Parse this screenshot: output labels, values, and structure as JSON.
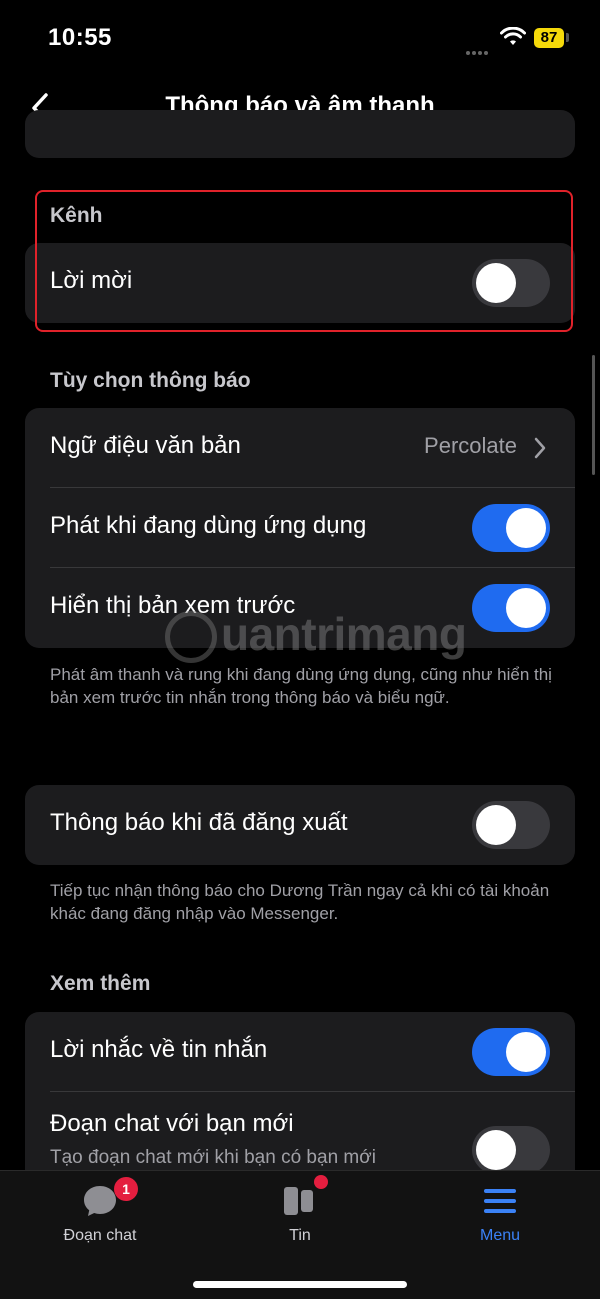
{
  "status_bar": {
    "time": "10:55",
    "battery": "87"
  },
  "nav": {
    "title": "Thông báo và âm thanh"
  },
  "channel_section": {
    "header": "Kênh",
    "rows": [
      {
        "label": "Lời mời",
        "toggle": "off"
      }
    ]
  },
  "notification_options": {
    "header": "Tùy chọn thông báo",
    "tone_label": "Ngữ điệu văn bản",
    "tone_value": "Percolate",
    "play_in_app_label": "Phát khi đang dùng ứng dụng",
    "play_in_app_toggle": "on",
    "show_preview_label": "Hiển thị bản xem trước",
    "show_preview_toggle": "on",
    "footnote": "Phát âm thanh và rung khi đang dùng ứng dụng, cũng như hiển thị bản xem trước tin nhắn trong thông báo và biểu ngữ."
  },
  "logged_out": {
    "label": "Thông báo khi đã đăng xuất",
    "toggle": "off",
    "footnote": "Tiếp tục nhận thông báo cho Dương Trần ngay cả khi có tài khoản khác đang đăng nhập vào Messenger."
  },
  "see_more": {
    "header": "Xem thêm",
    "reminder_label": "Lời nhắc về tin nhắn",
    "reminder_toggle": "on",
    "new_friend_label": "Đoạn chat với bạn mới",
    "new_friend_sublabel": "Tạo đoạn chat mới khi bạn có bạn mới",
    "new_friend_toggle": "off"
  },
  "watermark": {
    "text": "uantrimang"
  },
  "tabbar": {
    "chats_label": "Đoạn chat",
    "chats_badge": "1",
    "stories_label": "Tin",
    "menu_label": "Menu"
  },
  "colors": {
    "toggle_on": "#1f6bf0",
    "highlight_border": "#e0222a",
    "badge": "#e41e3f",
    "active_tab": "#3b82f6"
  }
}
